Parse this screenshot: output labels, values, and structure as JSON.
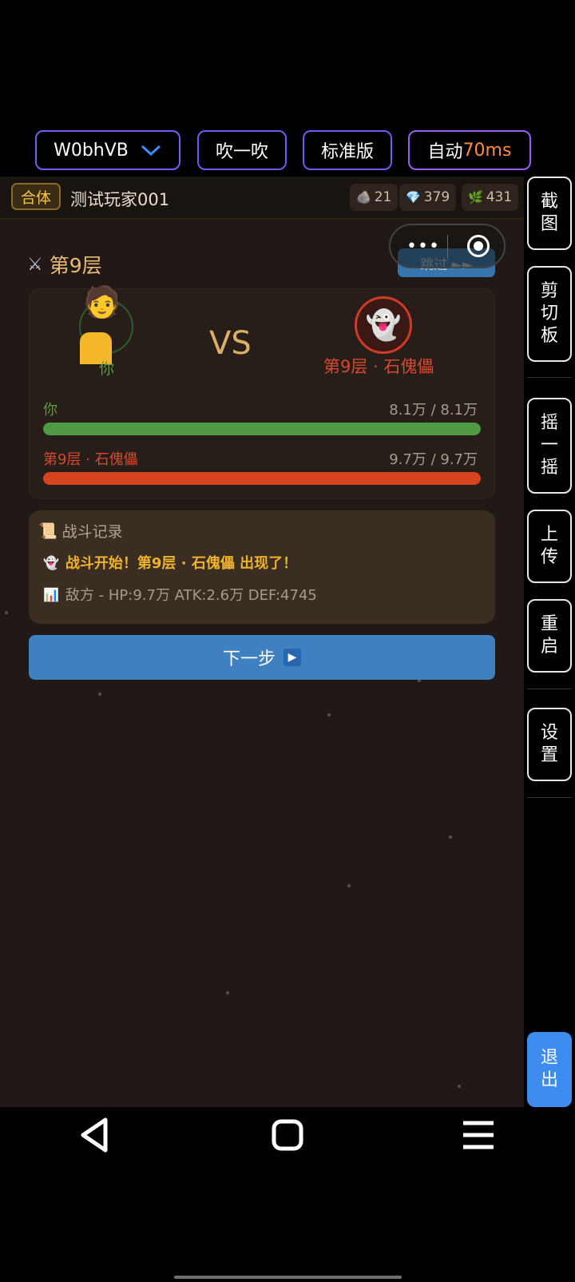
{
  "toolbar": {
    "app_id": "W0bhVB",
    "blow_label": "吹一吹",
    "version_label": "标准版",
    "auto_label": "自动",
    "auto_value": "70ms"
  },
  "side_buttons": {
    "screenshot": "截图",
    "clipboard": "剪切板",
    "shake": "摇一摇",
    "upload": "上传",
    "restart": "重启",
    "settings": "设置",
    "exit": "退出"
  },
  "header": {
    "realm_badge": "合体",
    "player_name": "测试玩家001",
    "resources": [
      {
        "icon": "stone-icon",
        "glyph": "🪨",
        "value": "21"
      },
      {
        "icon": "diamond-icon",
        "glyph": "💎",
        "value": "379"
      },
      {
        "icon": "herb-icon",
        "glyph": "🌿",
        "value": "431"
      }
    ]
  },
  "capsule": {
    "more_glyph": "•••"
  },
  "skip_label": "跳过 ►►",
  "battle": {
    "floor_title": "第9层",
    "vs_label": "VS",
    "player_label": "你",
    "enemy_label": "第9层 · 石傀儡",
    "player_hp_label": "你",
    "player_hp_text": "8.1万 / 8.1万",
    "player_hp_fraction": 1.0,
    "enemy_hp_label": "第9层 · 石傀儡",
    "enemy_hp_text": "9.7万 / 9.7万",
    "enemy_hp_fraction": 1.0,
    "player_color": "#4f9a43",
    "enemy_color": "#d7421f"
  },
  "log": {
    "title": "战斗记录",
    "lines": [
      {
        "icon": "ghost-icon",
        "glyph": "👻",
        "text": "战斗开始！第9层 · 石傀儡 出现了！",
        "color": "#f0b12c"
      },
      {
        "icon": "chart-icon",
        "glyph": "📊",
        "text": "敌方 - HP:9.7万 ATK:2.6万 DEF:4745",
        "color": "#a89a8b"
      }
    ]
  },
  "next_label": "下一步"
}
